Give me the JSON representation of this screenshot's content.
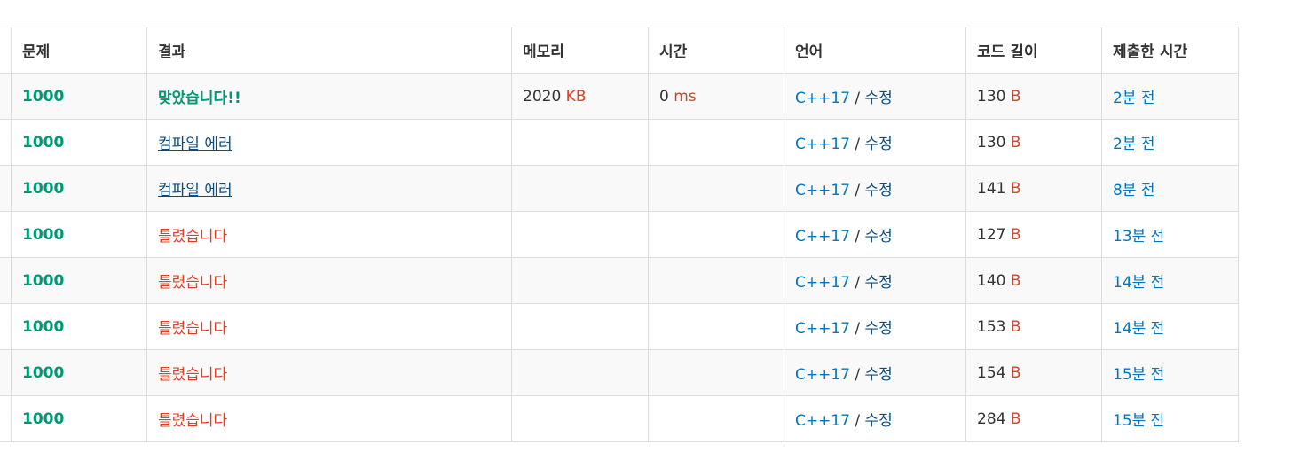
{
  "headers": [
    "문제",
    "결과",
    "메모리",
    "시간",
    "언어",
    "코드 길이",
    "제출한 시간"
  ],
  "units": {
    "memory": "KB",
    "time": "ms",
    "code": "B"
  },
  "lang_separator": " / ",
  "colors": {
    "accepted": "#009874",
    "wrong": "#dd4124",
    "compile_error": "#0b4c7e",
    "link": "#0076c0"
  },
  "rows": [
    {
      "problem": "1000",
      "result": "맞았습니다!!",
      "result_type": "ac",
      "memory": "2020",
      "time": "0",
      "lang": "C++17",
      "edit": "수정",
      "code_length": "130",
      "submitted": "2분 전"
    },
    {
      "problem": "1000",
      "result": "컴파일 에러",
      "result_type": "ce",
      "memory": "",
      "time": "",
      "lang": "C++17",
      "edit": "수정",
      "code_length": "130",
      "submitted": "2분 전"
    },
    {
      "problem": "1000",
      "result": "컴파일 에러",
      "result_type": "ce",
      "memory": "",
      "time": "",
      "lang": "C++17",
      "edit": "수정",
      "code_length": "141",
      "submitted": "8분 전"
    },
    {
      "problem": "1000",
      "result": "틀렸습니다",
      "result_type": "wa",
      "memory": "",
      "time": "",
      "lang": "C++17",
      "edit": "수정",
      "code_length": "127",
      "submitted": "13분 전"
    },
    {
      "problem": "1000",
      "result": "틀렸습니다",
      "result_type": "wa",
      "memory": "",
      "time": "",
      "lang": "C++17",
      "edit": "수정",
      "code_length": "140",
      "submitted": "14분 전"
    },
    {
      "problem": "1000",
      "result": "틀렸습니다",
      "result_type": "wa",
      "memory": "",
      "time": "",
      "lang": "C++17",
      "edit": "수정",
      "code_length": "153",
      "submitted": "14분 전"
    },
    {
      "problem": "1000",
      "result": "틀렸습니다",
      "result_type": "wa",
      "memory": "",
      "time": "",
      "lang": "C++17",
      "edit": "수정",
      "code_length": "154",
      "submitted": "15분 전"
    },
    {
      "problem": "1000",
      "result": "틀렸습니다",
      "result_type": "wa",
      "memory": "",
      "time": "",
      "lang": "C++17",
      "edit": "수정",
      "code_length": "284",
      "submitted": "15분 전"
    }
  ]
}
